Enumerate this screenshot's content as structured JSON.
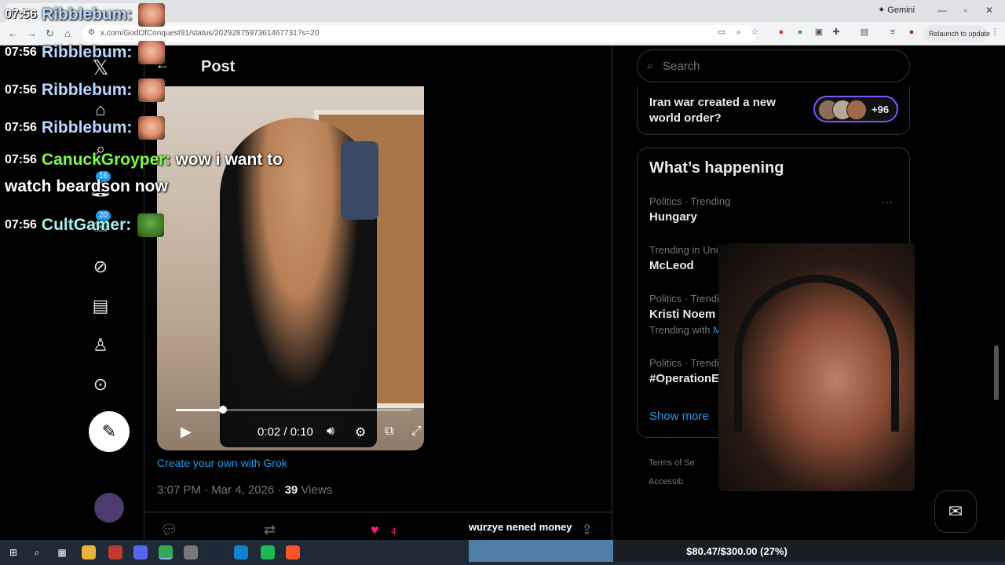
{
  "browser": {
    "tab_title": "(...)",
    "url": "x.com/GodOfConquest91/status/2029287597361467731?s=20",
    "gemini_label": "Gemini",
    "relaunch_label": "Relaunch to update"
  },
  "chat": {
    "messages": [
      {
        "time": "07:56",
        "user": "Ribblebum:",
        "color": "#b9d8ff",
        "text": "",
        "emote": "face"
      },
      {
        "time": "07:56",
        "user": "Ribblebum:",
        "color": "#b9d8ff",
        "text": "",
        "emote": "face"
      },
      {
        "time": "07:56",
        "user": "Ribblebum:",
        "color": "#b9d8ff",
        "text": "",
        "emote": "face"
      },
      {
        "time": "07:56",
        "user": "Ribblebum:",
        "color": "#b9d8ff",
        "text": "",
        "emote": "face"
      },
      {
        "time": "07:56",
        "user": "CanuckGroyper:",
        "color": "#7cfc4a",
        "text": "wow i want to",
        "emote": ""
      },
      {
        "time": "",
        "user": "",
        "color": "#ffffff",
        "text": "watch beardson now",
        "emote": ""
      },
      {
        "time": "07:56",
        "user": "CultGamer:",
        "color": "#a6f0f0",
        "text": "",
        "emote": "pepe"
      }
    ]
  },
  "leftnav": {
    "badge_notifications": "16",
    "badge_messages": "20"
  },
  "post": {
    "header_title": "Post",
    "video_time": "0:02 / 0:10",
    "video_progress": 0.2,
    "grok_link": "Create your own with Grok",
    "timestamp": "3:07 PM · Mar 4, 2026 · ",
    "views_count": "39",
    "views_label": " Views",
    "like_count": "4"
  },
  "sidebar": {
    "search_placeholder": "Search",
    "news_title": "Iran war created a new world order?",
    "news_count": "+96",
    "happening_title": "What’s happening",
    "trends": [
      {
        "meta": "Politics · Trending",
        "name": "Hungary",
        "with": "",
        "with_link": ""
      },
      {
        "meta": "Trending in United States",
        "name": "McLeod",
        "with": "",
        "with_link": ""
      },
      {
        "meta": "Politics · Trending",
        "name": "Kristi Noem",
        "with": "Trending with ",
        "with_link": "Mullin"
      },
      {
        "meta": "Politics · Trending",
        "name": "#OperationEpic",
        "with": "",
        "with_link": ""
      }
    ],
    "show_more": "Show more",
    "footer_terms": "Terms of Se",
    "footer_access": "Accessib"
  },
  "overlay": {
    "donation_text": "wurzye nened money",
    "goal_text": "$80.47/$300.00 (27%)",
    "goal_fraction": 0.27
  },
  "colors": {
    "accent": "#1d9bf0",
    "like": "#f91880"
  }
}
